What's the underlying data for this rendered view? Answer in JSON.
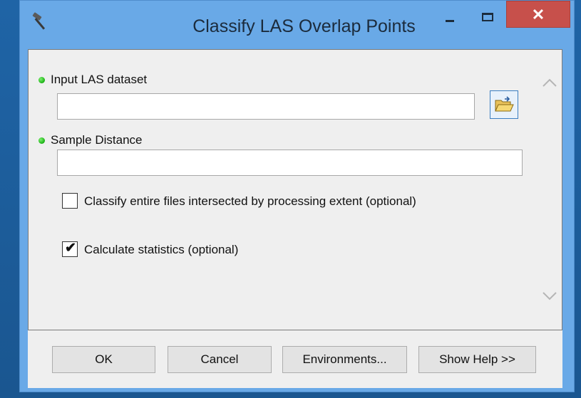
{
  "window": {
    "title": "Classify LAS Overlap Points",
    "app_icon": "hammer-icon",
    "controls": {
      "minimize": "minimize-icon",
      "maximize": "maximize-icon",
      "close": "close-icon",
      "close_glyph": "✕"
    }
  },
  "form": {
    "input_las_dataset": {
      "label": "Input LAS dataset",
      "value": "",
      "required": true,
      "browse_icon": "open-folder-icon"
    },
    "sample_distance": {
      "label": "Sample Distance",
      "value": "",
      "required": true
    },
    "classify_entire_files": {
      "label": "Classify entire files intersected by processing extent (optional)",
      "checked": false
    },
    "calculate_statistics": {
      "label": "Calculate statistics (optional)",
      "checked": true,
      "mark": "✔"
    }
  },
  "scrollbar": {
    "up_icon": "chevron-up-icon",
    "down_icon": "chevron-down-icon"
  },
  "buttons": {
    "ok": "OK",
    "cancel": "Cancel",
    "environments": "Environments...",
    "show_help": "Show Help >>"
  },
  "colors": {
    "title_bar": "#69a9e7",
    "close_button": "#c7504b",
    "required_dot": "#19b014",
    "panel": "#efefef"
  }
}
